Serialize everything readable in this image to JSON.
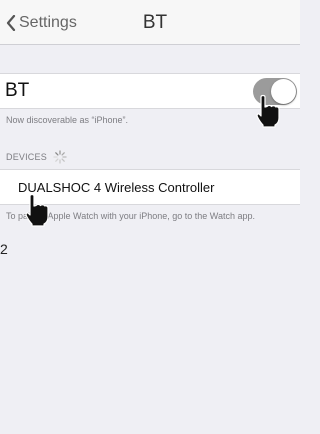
{
  "navbar": {
    "back_label": "Settings",
    "title": "BT",
    "back_icon": "chevron-left-icon"
  },
  "bluetooth": {
    "label": "BT",
    "toggle_on": true,
    "toggle_color": "#9b9b9b"
  },
  "discoverable_text": "Now discoverable as “iPhone”.",
  "devices": {
    "header": "DEVICES",
    "loading_icon": "spinner-icon",
    "items": [
      {
        "label": "DUALSHOC 4 Wireless Controller"
      }
    ]
  },
  "watch_note": "To pair an Apple Watch with your iPhone, go to the Watch app.",
  "edge_number": "2",
  "cursor_icon": "pointing-hand-icon"
}
